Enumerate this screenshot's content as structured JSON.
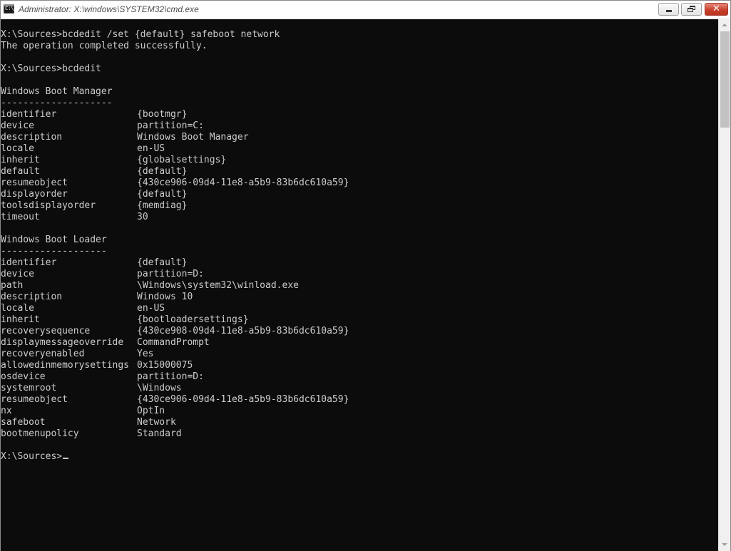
{
  "window": {
    "title": "Administrator: X:\\windows\\SYSTEM32\\cmd.exe",
    "minimize_icon": "minimize-icon",
    "maximize_icon": "restore-icon",
    "close_icon": "close-icon",
    "close_glyph": "✕"
  },
  "console": {
    "background": "#0c0c0c",
    "foreground": "#cccccc",
    "prompt": "X:\\Sources>",
    "lines": [
      {
        "text": "X:\\Sources>bcdedit /set {default} safeboot network"
      },
      {
        "text": "The operation completed successfully."
      },
      {
        "text": ""
      },
      {
        "text": "X:\\Sources>bcdedit"
      },
      {
        "text": ""
      },
      {
        "text": "Windows Boot Manager"
      },
      {
        "text": "--------------------"
      },
      {
        "key": "identifier",
        "value": "{bootmgr}"
      },
      {
        "key": "device",
        "value": "partition=C:"
      },
      {
        "key": "description",
        "value": "Windows Boot Manager"
      },
      {
        "key": "locale",
        "value": "en-US"
      },
      {
        "key": "inherit",
        "value": "{globalsettings}"
      },
      {
        "key": "default",
        "value": "{default}"
      },
      {
        "key": "resumeobject",
        "value": "{430ce906-09d4-11e8-a5b9-83b6dc610a59}"
      },
      {
        "key": "displayorder",
        "value": "{default}"
      },
      {
        "key": "toolsdisplayorder",
        "value": "{memdiag}"
      },
      {
        "key": "timeout",
        "value": "30"
      },
      {
        "text": ""
      },
      {
        "text": "Windows Boot Loader"
      },
      {
        "text": "-------------------"
      },
      {
        "key": "identifier",
        "value": "{default}"
      },
      {
        "key": "device",
        "value": "partition=D:"
      },
      {
        "key": "path",
        "value": "\\Windows\\system32\\winload.exe"
      },
      {
        "key": "description",
        "value": "Windows 10"
      },
      {
        "key": "locale",
        "value": "en-US"
      },
      {
        "key": "inherit",
        "value": "{bootloadersettings}"
      },
      {
        "key": "recoverysequence",
        "value": "{430ce908-09d4-11e8-a5b9-83b6dc610a59}"
      },
      {
        "key": "displaymessageoverride",
        "value": "CommandPrompt"
      },
      {
        "key": "recoveryenabled",
        "value": "Yes"
      },
      {
        "key": "allowedinmemorysettings",
        "value": "0x15000075"
      },
      {
        "key": "osdevice",
        "value": "partition=D:"
      },
      {
        "key": "systemroot",
        "value": "\\Windows"
      },
      {
        "key": "resumeobject",
        "value": "{430ce906-09d4-11e8-a5b9-83b6dc610a59}"
      },
      {
        "key": "nx",
        "value": "OptIn"
      },
      {
        "key": "safeboot",
        "value": "Network"
      },
      {
        "key": "bootmenupolicy",
        "value": "Standard"
      },
      {
        "text": ""
      }
    ]
  }
}
